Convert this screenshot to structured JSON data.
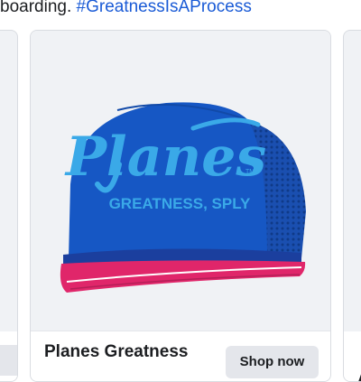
{
  "post": {
    "caption_text": "boarding. ",
    "caption_hashtag": "#GreatnessIsAProcess"
  },
  "carousel": {
    "card": {
      "title": "Planes Greatness",
      "cta_label": "Shop now",
      "product_image": {
        "logo_script": "Planes",
        "tm_mark": "TM",
        "tagline": "GREATNESS, SPLY",
        "colors": {
          "cap": "#1657c4",
          "logo": "#3aa9e8",
          "brim_red": "#e0266a"
        }
      }
    },
    "next_card_peek": {
      "letter": "A"
    }
  }
}
